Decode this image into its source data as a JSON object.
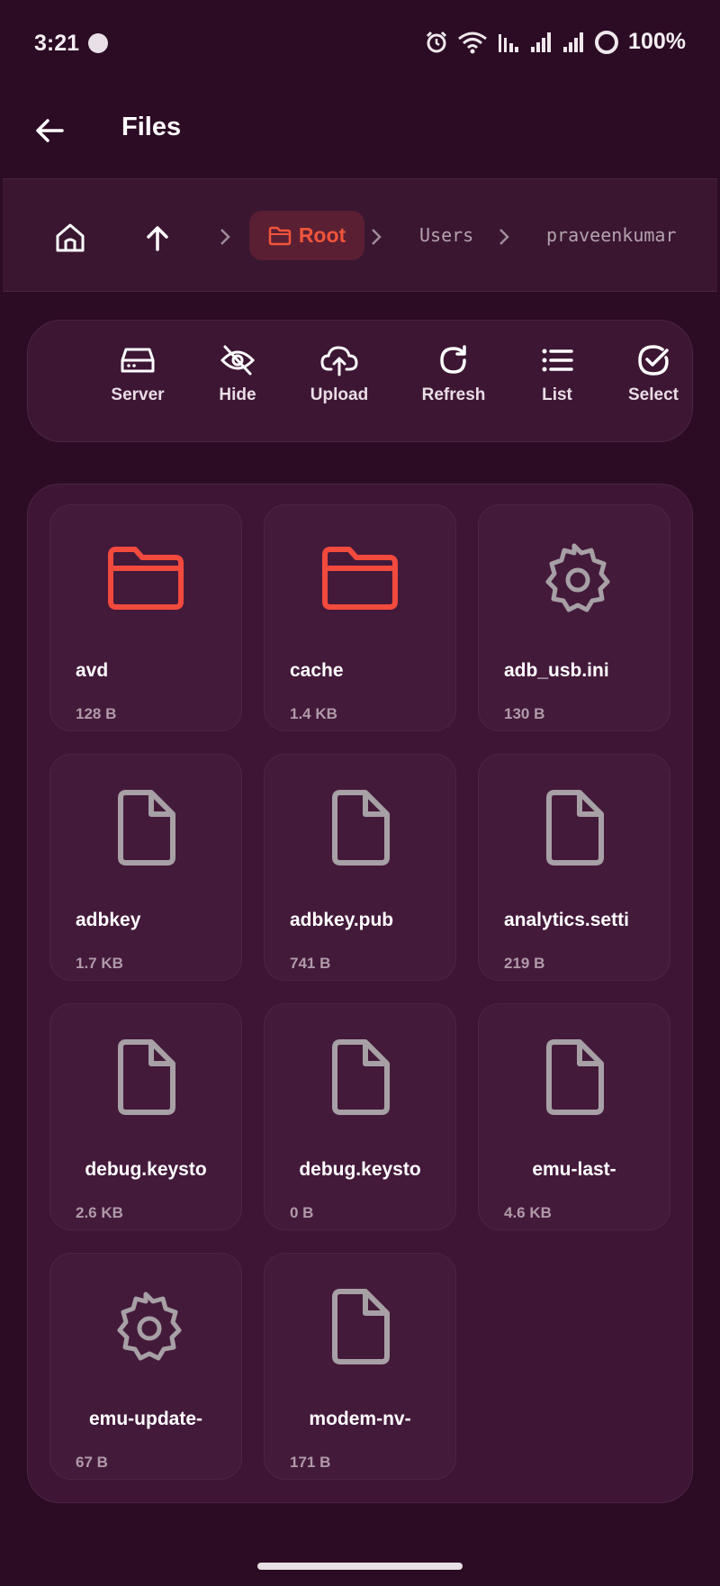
{
  "status_bar": {
    "time": "3:21",
    "battery": "100%"
  },
  "app_bar": {
    "title": "Files"
  },
  "breadcrumb": {
    "current": "Root",
    "segments": [
      "Users",
      "praveenkumar"
    ]
  },
  "toolbar": {
    "server": "Server",
    "hide": "Hide",
    "upload": "Upload",
    "refresh": "Refresh",
    "list": "List",
    "select": "Select"
  },
  "files": [
    {
      "name": "avd",
      "size": "128 B",
      "icon": "folder-icon"
    },
    {
      "name": "cache",
      "size": "1.4 KB",
      "icon": "folder-icon"
    },
    {
      "name": "adb_usb.ini",
      "size": "130 B",
      "icon": "gear-icon"
    },
    {
      "name": "adbkey",
      "size": "1.7 KB",
      "icon": "file-icon"
    },
    {
      "name": "adbkey.pub",
      "size": "741 B",
      "icon": "file-icon"
    },
    {
      "name": "analytics.setti",
      "size": "219 B",
      "icon": "file-icon"
    },
    {
      "name": "debug.keysto",
      "size": "2.6 KB",
      "icon": "file-icon"
    },
    {
      "name": "debug.keysto",
      "size": "0 B",
      "icon": "file-icon"
    },
    {
      "name": "emu-last-",
      "size": "4.6 KB",
      "icon": "file-icon"
    },
    {
      "name": "emu-update-",
      "size": "67 B",
      "icon": "gear-icon"
    },
    {
      "name": "modem-nv-",
      "size": "171 B",
      "icon": "file-icon"
    }
  ],
  "colors": {
    "background": "#2c0b24",
    "accent": "#f0553b",
    "folder": "#f24a3d",
    "icon_gray": "#a7a0a5"
  }
}
